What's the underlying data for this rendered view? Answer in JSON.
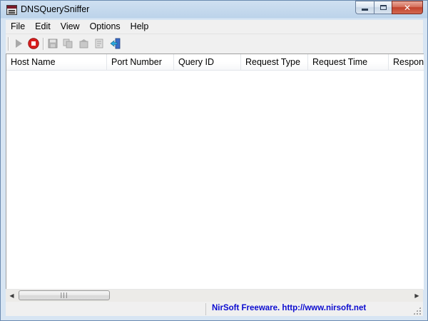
{
  "window": {
    "title": "DNSQuerySniffer"
  },
  "caption_buttons": {
    "close_glyph": "✕"
  },
  "menu": [
    "File",
    "Edit",
    "View",
    "Options",
    "Help"
  ],
  "toolbar": {
    "buttons": [
      {
        "name": "start-capture",
        "icon": "play-icon",
        "enabled": false
      },
      {
        "name": "stop-capture",
        "icon": "stop-icon",
        "enabled": true
      },
      {
        "name": "save-selected",
        "icon": "save-icon",
        "enabled": false
      },
      {
        "name": "copy-selected",
        "icon": "copy-icon",
        "enabled": false
      },
      {
        "name": "html-report",
        "icon": "report-icon",
        "enabled": false
      },
      {
        "name": "properties",
        "icon": "properties-icon",
        "enabled": false
      },
      {
        "name": "exit",
        "icon": "exit-icon",
        "enabled": true
      }
    ]
  },
  "columns": [
    "Host Name",
    "Port Number",
    "Query ID",
    "Request Type",
    "Request Time",
    "Response"
  ],
  "rows": [],
  "scrollbar": {
    "left_arrow": "◀",
    "right_arrow": "▶",
    "grip": "|||"
  },
  "statusbar": {
    "link_text": "NirSoft Freeware.  http://www.nirsoft.net"
  },
  "colors": {
    "link": "#0b0bd0",
    "stop": "#d81e1e",
    "titlebar": "#bcd3ea"
  }
}
